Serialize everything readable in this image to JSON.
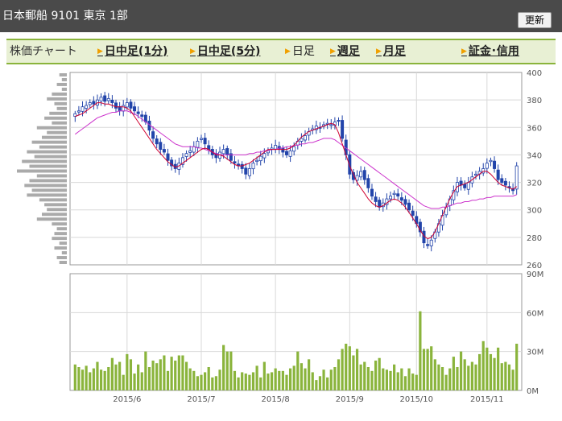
{
  "header": {
    "title": "日本郵船  9101  東京 1部",
    "refresh_label": "更新"
  },
  "nav": {
    "current_label": "株価チャート",
    "items": [
      {
        "label": "日中足(1分)",
        "link": true
      },
      {
        "label": "日中足(5分)",
        "link": true
      },
      {
        "label": "日足",
        "link": false
      },
      {
        "label": "週足",
        "link": true
      },
      {
        "label": "月足",
        "link": true
      },
      {
        "label": "証金･信用",
        "link": true
      }
    ]
  },
  "colors": {
    "up": "#2244aa",
    "down": "#2244aa",
    "ma_short": "#d00030",
    "ma_long": "#cc33cc",
    "volume": "#8ab43c",
    "vol_profile": "#aaaaaa"
  },
  "chart_data": {
    "type": "candlestick",
    "price_axis": {
      "ticks": [
        "400",
        "380",
        "360",
        "340",
        "320",
        "300",
        "280",
        "260"
      ],
      "ylim": [
        260,
        400
      ]
    },
    "volume_axis": {
      "ticks": [
        "90M",
        "60M",
        "30M",
        "0M"
      ],
      "ylim": [
        0,
        90
      ]
    },
    "x_ticks": [
      "2015/6",
      "2015/7",
      "2015/8",
      "2015/9",
      "2015/10",
      "2015/11"
    ],
    "x_tick_index": [
      14,
      34,
      54,
      74,
      92,
      111
    ],
    "closes": [
      370,
      372,
      375,
      376,
      378,
      377,
      380,
      382,
      379,
      381,
      378,
      374,
      372,
      376,
      378,
      374,
      372,
      370,
      368,
      364,
      358,
      352,
      348,
      344,
      342,
      336,
      332,
      330,
      334,
      338,
      341,
      343,
      346,
      350,
      352,
      348,
      344,
      340,
      338,
      342,
      344,
      340,
      336,
      334,
      332,
      330,
      326,
      330,
      334,
      336,
      339,
      341,
      343,
      345,
      347,
      344,
      342,
      340,
      343,
      346,
      350,
      352,
      354,
      357,
      359,
      361,
      360,
      362,
      363,
      362,
      364,
      365,
      352,
      340,
      326,
      322,
      325,
      328,
      322,
      316,
      310,
      306,
      302,
      305,
      308,
      310,
      312,
      310,
      307,
      304,
      300,
      296,
      290,
      284,
      276,
      274,
      278,
      284,
      290,
      296,
      302,
      308,
      314,
      320,
      318,
      316,
      320,
      324,
      326,
      328,
      330,
      334,
      336,
      330,
      322,
      320,
      318,
      316,
      314,
      332
    ],
    "ma_short": [
      368,
      369,
      370,
      372,
      374,
      376,
      378,
      378,
      377,
      377,
      376,
      375,
      375,
      375,
      374,
      372,
      368,
      364,
      360,
      356,
      352,
      348,
      344,
      341,
      338,
      335,
      333,
      331,
      332,
      334,
      336,
      338,
      340,
      342,
      344,
      345,
      344,
      342,
      340,
      340,
      339,
      337,
      335,
      333,
      332,
      332,
      333,
      334,
      336,
      338,
      340,
      342,
      344,
      344,
      344,
      344,
      344,
      344,
      345,
      347,
      350,
      353,
      355,
      357,
      358,
      359,
      360,
      361,
      362,
      363,
      362,
      356,
      348,
      340,
      332,
      326,
      320,
      316,
      312,
      308,
      305,
      303,
      302,
      303,
      305,
      307,
      308,
      307,
      305,
      302,
      298,
      294,
      290,
      285,
      281,
      279,
      280,
      284,
      290,
      296,
      302,
      308,
      313,
      317,
      318,
      319,
      320,
      322,
      324,
      326,
      328,
      328,
      326,
      323,
      320,
      318,
      317,
      316,
      315,
      317
    ],
    "ma_long": [
      355,
      357,
      359,
      361,
      363,
      365,
      367,
      368,
      369,
      370,
      371,
      371,
      372,
      372,
      372,
      371,
      370,
      368,
      366,
      364,
      362,
      360,
      358,
      356,
      354,
      352,
      350,
      348,
      347,
      346,
      346,
      346,
      346,
      345,
      345,
      344,
      343,
      342,
      341,
      340,
      340,
      340,
      340,
      340,
      340,
      340,
      340,
      341,
      341,
      342,
      342,
      343,
      343,
      344,
      344,
      345,
      345,
      346,
      346,
      347,
      347,
      348,
      348,
      349,
      349,
      350,
      351,
      352,
      352,
      352,
      351,
      349,
      347,
      345,
      343,
      341,
      339,
      337,
      335,
      333,
      331,
      329,
      327,
      325,
      323,
      321,
      319,
      317,
      315,
      313,
      311,
      309,
      307,
      305,
      303,
      302,
      301,
      301,
      301,
      302,
      302,
      303,
      304,
      305,
      305,
      306,
      306,
      307,
      307,
      308,
      308,
      309,
      309,
      310,
      310,
      310,
      310,
      310,
      310,
      311
    ],
    "volumes": [
      20,
      18,
      16,
      19,
      14,
      17,
      22,
      16,
      15,
      18,
      25,
      20,
      22,
      12,
      28,
      24,
      13,
      20,
      14,
      30,
      18,
      23,
      21,
      24,
      27,
      15,
      26,
      23,
      27,
      27,
      22,
      17,
      15,
      11,
      12,
      14,
      18,
      10,
      11,
      16,
      35,
      30,
      30,
      15,
      10,
      14,
      13,
      12,
      14,
      19,
      10,
      22,
      13,
      14,
      17,
      15,
      15,
      12,
      17,
      19,
      30,
      21,
      17,
      24,
      14,
      8,
      11,
      16,
      10,
      16,
      18,
      24,
      32,
      36,
      34,
      27,
      32,
      20,
      22,
      18,
      15,
      23,
      25,
      17,
      16,
      15,
      20,
      14,
      17,
      11,
      17,
      13,
      12,
      61,
      32,
      32,
      34,
      24,
      20,
      18,
      12,
      17,
      26,
      18,
      30,
      24,
      19,
      22,
      20,
      28,
      38,
      33,
      28,
      25,
      33,
      21,
      22,
      20,
      16,
      36
    ],
    "vol_profile": [
      3,
      2,
      4,
      2,
      6,
      8,
      5,
      4,
      7,
      9,
      6,
      12,
      8,
      10,
      14,
      11,
      16,
      13,
      18,
      15,
      20,
      12,
      15,
      17,
      14,
      16,
      11,
      9,
      8,
      10,
      12,
      6,
      4,
      5,
      6,
      3,
      5,
      2,
      4,
      3
    ]
  }
}
